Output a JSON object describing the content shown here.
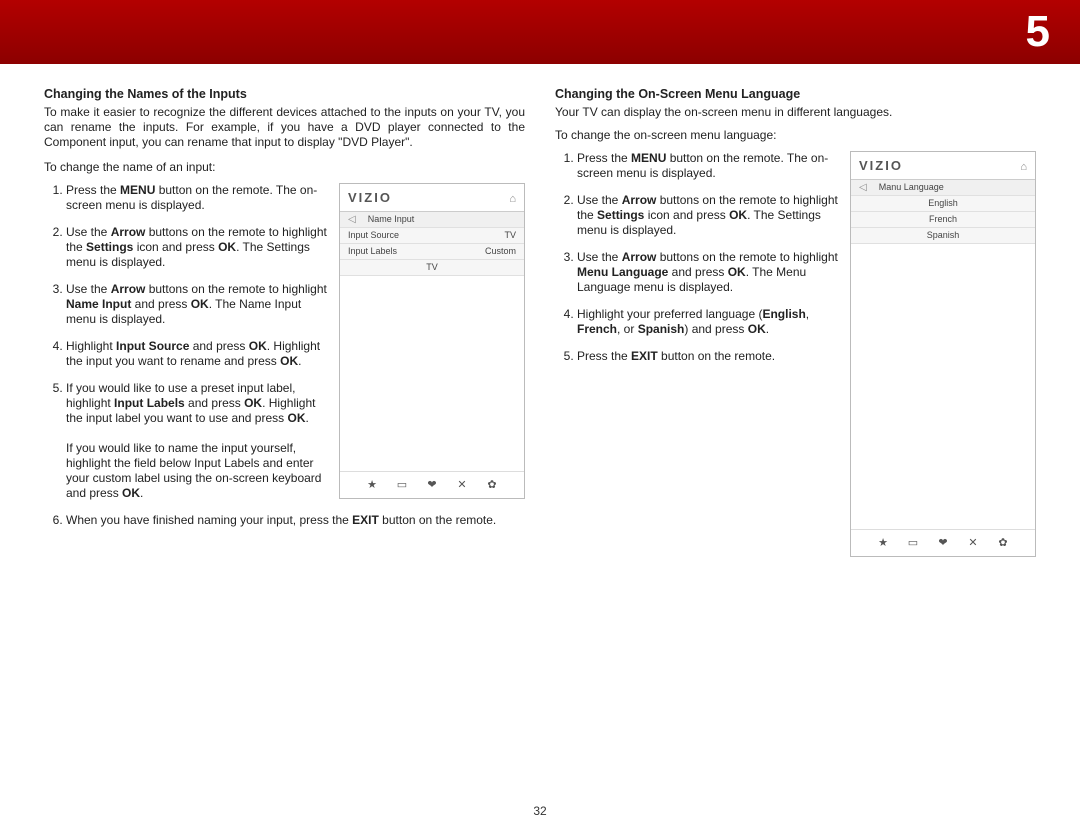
{
  "chapterNumber": "5",
  "pageNumber": "32",
  "left": {
    "heading": "Changing the Names of the Inputs",
    "intro": "To make it easier to recognize the different devices attached to the inputs on your TV, you can rename the inputs. For example, if you have a DVD player connected to the Component input, you can rename that input to display \"DVD Player\".",
    "lead": "To change the name of an input:",
    "steps": {
      "s1a": "Press the ",
      "s1b": "MENU",
      "s1c": " button on the remote. The on-screen menu is displayed.",
      "s2a": "Use the ",
      "s2b": "Arrow",
      "s2c": " buttons on the remote to highlight the ",
      "s2d": "Settings",
      "s2e": " icon and press ",
      "s2f": "OK",
      "s2g": ". The Settings menu is displayed.",
      "s3a": "Use the ",
      "s3b": "Arrow",
      "s3c": " buttons on the remote to highlight ",
      "s3d": "Name Input",
      "s3e": " and press ",
      "s3f": "OK",
      "s3g": ". The Name Input menu is displayed.",
      "s4a": "Highlight ",
      "s4b": "Input Source",
      "s4c": " and press ",
      "s4d": "OK",
      "s4e": ". Highlight the input you want to rename and press ",
      "s4f": "OK",
      "s4g": ".",
      "s5a": "If you would like to use a preset input label, highlight ",
      "s5b": "Input Labels",
      "s5c": " and press ",
      "s5d": "OK",
      "s5e": ". Highlight the input label you want to use and press ",
      "s5f": "OK",
      "s5g": ".",
      "s5p2a": "If you would like to name the input yourself, highlight the field below Input Labels and enter your custom label using the on-screen keyboard and press ",
      "s5p2b": "OK",
      "s5p2c": ".",
      "s6a": "When you have finished naming your input, press the ",
      "s6b": "EXIT",
      "s6c": " button on the remote."
    },
    "panel": {
      "brand": "VIZIO",
      "title": "Name Input",
      "row1l": "Input Source",
      "row1r": "TV",
      "row2l": "Input Labels",
      "row2r": "Custom",
      "row3": "TV"
    }
  },
  "right": {
    "heading": "Changing the On-Screen Menu Language",
    "intro": "Your TV can display the on-screen menu in different languages.",
    "lead": "To change the on-screen menu language:",
    "steps": {
      "s1a": "Press the ",
      "s1b": "MENU",
      "s1c": " button on the remote. The on-screen menu is displayed.",
      "s2a": "Use the ",
      "s2b": "Arrow",
      "s2c": " buttons on the remote to highlight the ",
      "s2d": "Settings",
      "s2e": " icon and press ",
      "s2f": "OK",
      "s2g": ". The Settings menu is displayed.",
      "s3a": "Use the ",
      "s3b": "Arrow",
      "s3c": " buttons on the remote to highlight ",
      "s3d": "Menu Language",
      "s3e": " and press ",
      "s3f": "OK",
      "s3g": ". The Menu Language menu is displayed.",
      "s4a": "Highlight your preferred language (",
      "s4b": "English",
      "s4c": ", ",
      "s4d": "French",
      "s4e": ", or ",
      "s4f": "Spanish",
      "s4g": ") and press ",
      "s4h": "OK",
      "s4i": ".",
      "s5a": "Press the ",
      "s5b": "EXIT",
      "s5c": " button on the remote."
    },
    "panel": {
      "brand": "VIZIO",
      "title": "Manu Language",
      "opt1": "English",
      "opt2": "French",
      "opt3": "Spanish"
    }
  },
  "footerIcons": {
    "star": "★",
    "cc": "▭",
    "v": "❤",
    "x": "✕",
    "gear": "✿"
  }
}
